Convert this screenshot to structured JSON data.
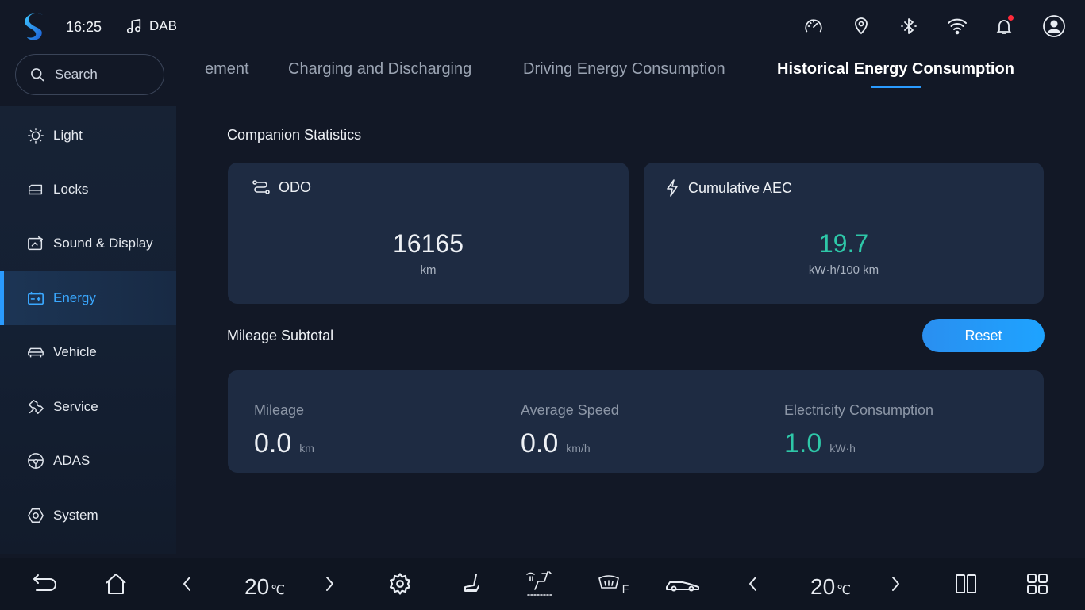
{
  "status_bar": {
    "time": "16:25",
    "media_source": "DAB",
    "icons": [
      "speed-gauge-icon",
      "location-pin-icon",
      "bluetooth-icon",
      "wifi-icon",
      "bell-icon",
      "user-avatar-icon"
    ]
  },
  "sidebar": {
    "search_placeholder": "Search",
    "items": [
      {
        "label": "Light",
        "icon": "light-icon"
      },
      {
        "label": "Locks",
        "icon": "lock-icon"
      },
      {
        "label": "Sound & Display",
        "icon": "display-icon"
      },
      {
        "label": "Energy",
        "icon": "battery-icon",
        "active": true
      },
      {
        "label": "Vehicle",
        "icon": "car-icon"
      },
      {
        "label": "Service",
        "icon": "wrench-icon"
      },
      {
        "label": "ADAS",
        "icon": "steering-wheel-icon"
      },
      {
        "label": "System",
        "icon": "hexagon-settings-icon"
      }
    ]
  },
  "tabs": [
    {
      "label": "Energy Management (partially visible)",
      "display": "ement"
    },
    {
      "label": "Charging and Discharging"
    },
    {
      "label": "Driving Energy Consumption"
    },
    {
      "label": "Historical Energy Consumption",
      "active": true
    }
  ],
  "companion": {
    "title": "Companion Statistics",
    "odo": {
      "label": "ODO",
      "value": "16165",
      "unit": "km"
    },
    "aec": {
      "label": "Cumulative AEC",
      "value": "19.7",
      "unit": "kW·h/100 km"
    }
  },
  "subtotal": {
    "title": "Mileage Subtotal",
    "reset_label": "Reset",
    "mileage": {
      "label": "Mileage",
      "value": "0.0",
      "unit": "km"
    },
    "speed": {
      "label": "Average Speed",
      "value": "0.0",
      "unit": "km/h"
    },
    "electricity": {
      "label": "Electricity Consumption",
      "value": "1.0",
      "unit": "kW·h"
    }
  },
  "dock": {
    "left_temp": "20",
    "right_temp": "20",
    "temp_unit": "℃",
    "rear_defrost_label": "F"
  },
  "colors": {
    "accent": "#2a9bff",
    "value_green": "#2ec7a8",
    "card_bg": "#1e2b42",
    "page_bg": "#121826"
  }
}
